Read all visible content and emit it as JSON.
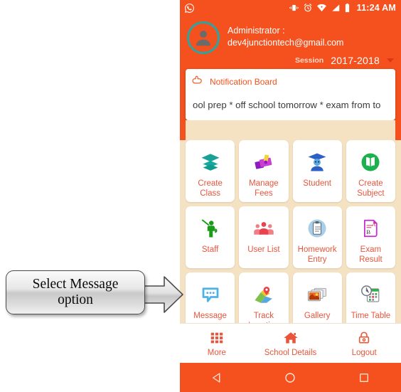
{
  "callout": {
    "line1": "Select Message",
    "line2": "option",
    "arrow_icon": "right-arrow-icon"
  },
  "phone": {
    "status_bar": {
      "app_icon": "whatsapp-icon",
      "icons": [
        "vibrate-icon",
        "alarm-clock-icon",
        "wifi-icon",
        "signal-icon",
        "battery-icon"
      ],
      "time": "11:24 AM"
    },
    "header": {
      "avatar_icon": "user-avatar-icon",
      "role_label": "Administrator :",
      "email": "dev4junctiontech@gmail.com",
      "session_label": "Session",
      "session_value": "2017-2018",
      "session_caret_icon": "chevron-down-icon",
      "accent_color": "#f4511e",
      "avatar_ring_color": "#2fa3a0"
    },
    "notification": {
      "hand_icon": "pointing-hand-icon",
      "title": "Notification Board",
      "message": "ool prep * off school tomorrow * exam from to"
    },
    "grid": {
      "rows": [
        [
          {
            "label": "Create\nClass",
            "icon": "layers-icon"
          },
          {
            "label": "Manage\nFees",
            "icon": "money-icon"
          },
          {
            "label": "Student",
            "icon": "graduate-student-icon"
          },
          {
            "label": "Create\nSubject",
            "icon": "open-book-icon"
          }
        ],
        [
          {
            "label": "Staff",
            "icon": "teacher-pointer-icon"
          },
          {
            "label": "User List",
            "icon": "people-group-icon"
          },
          {
            "label": "Homework\nEntry",
            "icon": "clipboard-icon"
          },
          {
            "label": "Exam\nResult",
            "icon": "grade-paper-icon"
          }
        ],
        [
          {
            "label": "Message",
            "icon": "speech-bubble-icon"
          },
          {
            "label": "Track\nLocation",
            "icon": "map-pin-icon"
          },
          {
            "label": "Gallery",
            "icon": "photos-icon"
          },
          {
            "label": "Time Table",
            "icon": "calendar-clock-icon"
          }
        ]
      ],
      "background_color": "#f4e2c3",
      "label_color": "#e8553b"
    },
    "bottom_nav": [
      {
        "label": "More",
        "icon": "grid-dots-icon"
      },
      {
        "label": "School Details",
        "icon": "home-icon"
      },
      {
        "label": "Logout",
        "icon": "lock-icon"
      }
    ],
    "android_nav": [
      {
        "name": "back-button",
        "icon": "triangle-back-icon"
      },
      {
        "name": "home-button",
        "icon": "circle-home-icon"
      },
      {
        "name": "recents-button",
        "icon": "square-recents-icon"
      }
    ]
  }
}
